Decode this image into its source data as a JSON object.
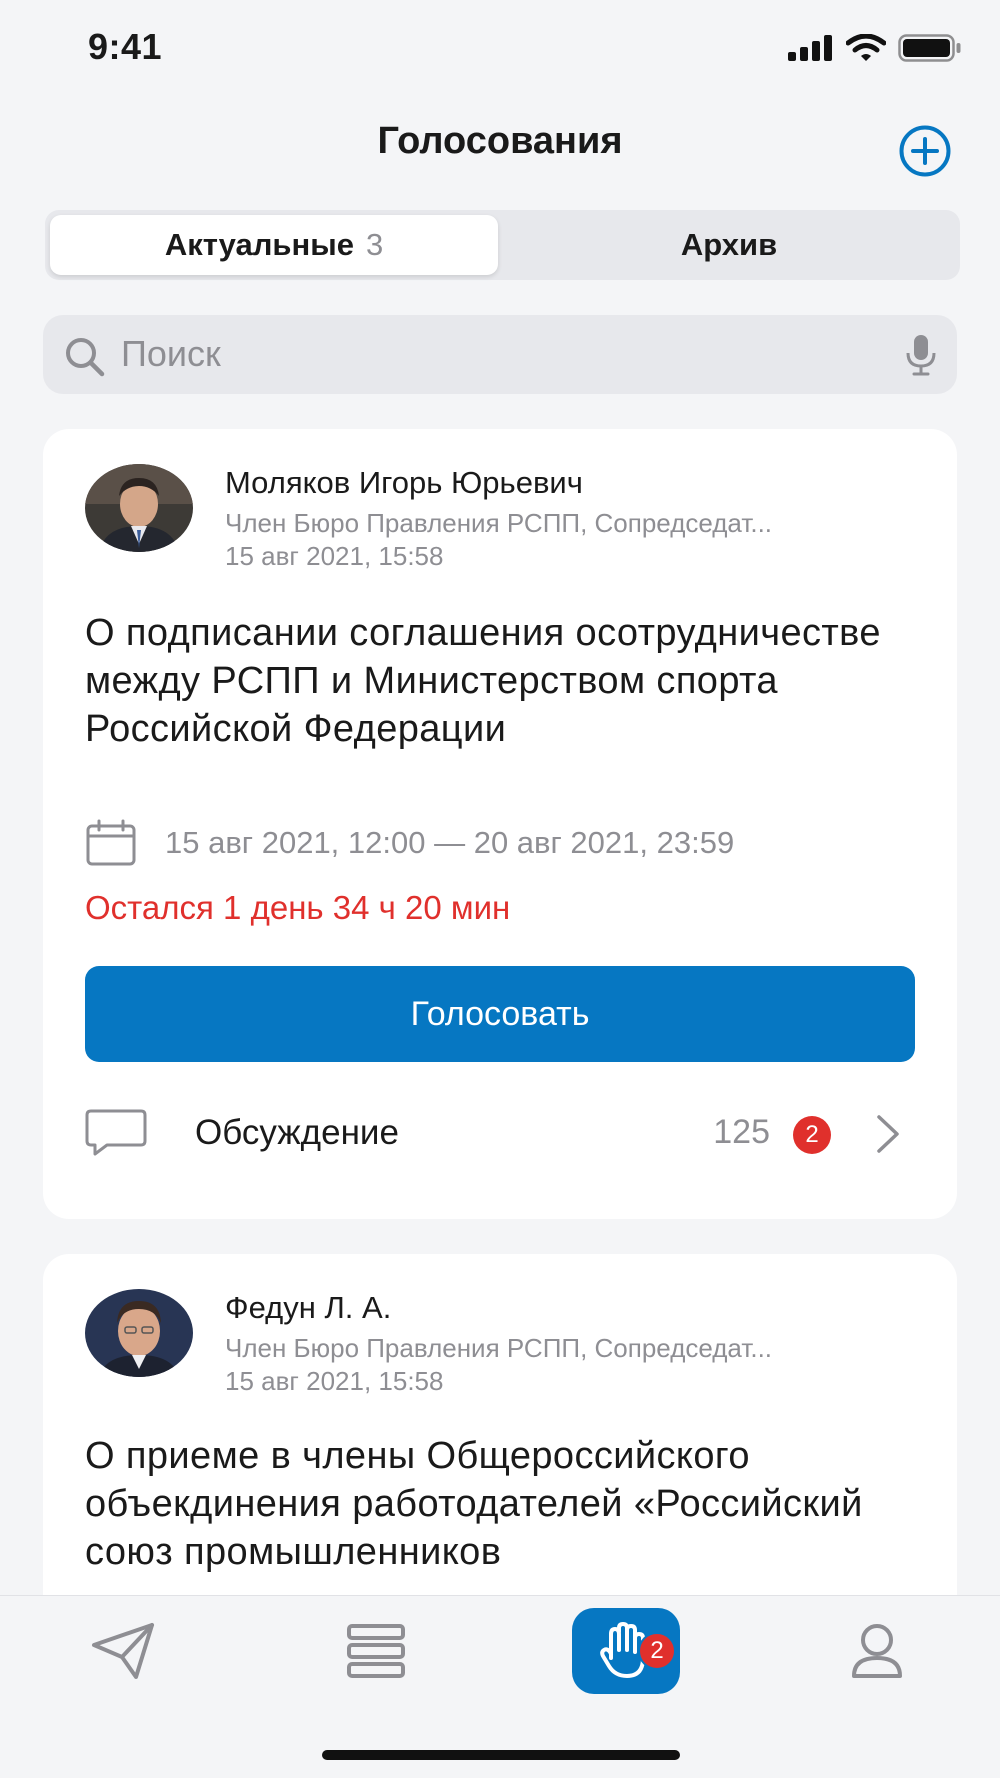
{
  "status_bar": {
    "time": "9:41"
  },
  "header": {
    "title": "Голосования"
  },
  "segments": {
    "active_label": "Актуальные",
    "active_count": "3",
    "archive_label": "Архив"
  },
  "search": {
    "placeholder": "Поиск"
  },
  "cards": [
    {
      "author": "Моляков Игорь Юрьевич",
      "role": "Член Бюро Правления РСПП, Сопредседат...",
      "posted": "15 авг 2021, 15:58",
      "title": "О подписании соглашения осотрудничестве между РСПП и Министерством спорта Российской Федерации",
      "period": "15 авг 2021, 12:00 — 20 авг 2021, 23:59",
      "remaining": "Остался 1 день 34 ч 20 мин",
      "vote_label": "Голосовать",
      "discussion_label": "Обсуждение",
      "discussion_count": "125",
      "discussion_badge": "2"
    },
    {
      "author": "Федун Л. А.",
      "role": "Член Бюро Правления РСПП, Сопредседат...",
      "posted": "15 авг 2021, 15:58",
      "title": "О приеме в члены Общероссийского объекдинения работодателей «Российский союз промышленников"
    }
  ],
  "tab_bar": {
    "items": [
      {
        "icon": "send-icon"
      },
      {
        "icon": "stack-icon"
      },
      {
        "icon": "raised-hand-icon",
        "badge": "2",
        "active": true
      },
      {
        "icon": "profile-icon"
      }
    ]
  },
  "colors": {
    "accent": "#0677c2",
    "alert": "#e0302c",
    "secondary_text": "#8e8e93"
  }
}
